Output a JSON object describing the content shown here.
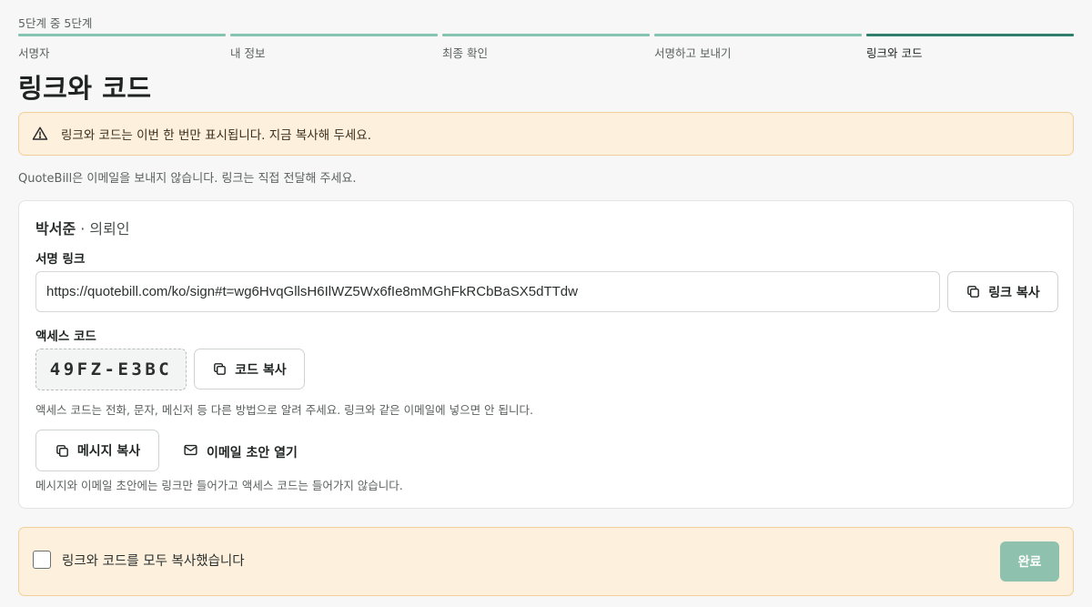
{
  "stepper": {
    "count": "5단계 중 5단계",
    "steps": [
      {
        "label": "서명자"
      },
      {
        "label": "내 정보"
      },
      {
        "label": "최종 확인"
      },
      {
        "label": "서명하고 보내기"
      },
      {
        "label": "링크와 코드"
      }
    ],
    "current_index": 4
  },
  "title": "링크와 코드",
  "warning": {
    "icon": "warning-triangle-icon",
    "text": "링크와 코드는 이번 한 번만 표시됩니다. 지금 복사해 두세요."
  },
  "note": "QuoteBill은 이메일을 보내지 않습니다. 링크는 직접 전달해 주세요.",
  "card": {
    "signer_name": "박서준",
    "signer_role": " · 의뢰인",
    "sign_link_label": "서명 링크",
    "sign_link_value": "https://quotebill.com/ko/sign#t=wg6HvqGllsH6IlWZ5Wx6fIe8mMGhFkRCbBaSX5dTTdw",
    "copy_link_button": "링크 복사",
    "access_code_label": "액세스 코드",
    "access_code": "49FZ-E3BC",
    "copy_code_button": "코드 복사",
    "access_code_help": "액세스 코드는 전화, 문자, 메신저 등 다른 방법으로 알려 주세요. 링크와 같은 이메일에 넣으면 안 됩니다.",
    "copy_message_button": "메시지 복사",
    "open_email_button": "이메일 초안 열기",
    "message_help": "메시지와 이메일 초안에는 링크만 들어가고 액세스 코드는 들어가지 않습니다."
  },
  "confirm": {
    "checkbox_label": "링크와 코드를 모두 복사했습니다",
    "checked": false,
    "done_button": "완료"
  },
  "colors": {
    "accent": "#2f7f6d",
    "accent_light": "#86c4b2",
    "warning_bg": "#fdf0dc",
    "warning_border": "#f0cf9a",
    "done_button_disabled": "#8fc1af"
  }
}
